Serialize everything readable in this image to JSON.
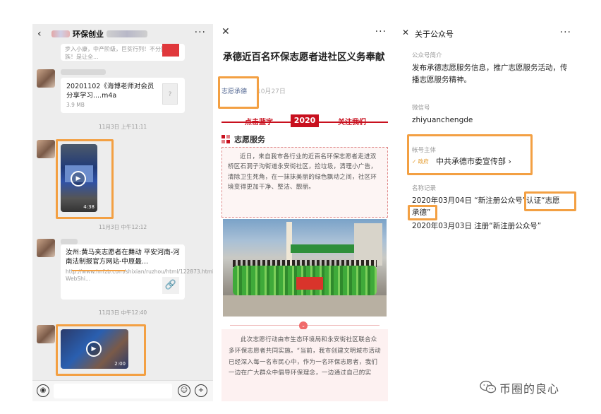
{
  "chat": {
    "title": "环保创业",
    "more": "···",
    "snippet": "步入小康，中产阶级，巨贫行列！不分民族种族！是让全...",
    "file": {
      "name": "20201102《海博老师对会员分享学习....m4a",
      "size": "3.9 MB",
      "icon_glyph": "?"
    },
    "timestamps": [
      "11月3日 上午11:11",
      "11月3日 中午12:12",
      "11月3日 中午12:40"
    ],
    "video1_duration": "4:38",
    "video2_duration": "2:00",
    "link": {
      "title": "汝州:黄马夹志愿者在舞动 平安河南-河南法制报官方网站-中原最...",
      "url": "http://www.hnfzb.com/shixian/ruzhou/html/122873.html?WebShi..."
    }
  },
  "article": {
    "title": "承德近百名环保志愿者进社区义务奉献",
    "author": "志愿承德",
    "date": "10月27日",
    "banner": {
      "left": "点击蓝字",
      "mid": "2020",
      "right": "关注我们"
    },
    "section_title": "志愿服务",
    "paragraph1": "近日，来自我市各行业的近百名环保志愿者走进双桥区石洞子沟街道永安街社区，捡垃圾，清理小广告，清除卫生死角，在一抹抹美丽的绿色飘动之间，社区环境变得更加干净、整洁、靓丽。",
    "paragraph2": "此次志愿行动由市生态环境局和永安街社区联合众多环保志愿者共同实施。“当前，我市创建文明城市活动已经深入每一名市民心中，作为一名环保志愿者，我们一边在广大群众中倡导环保理念，一边通过自己的实"
  },
  "account": {
    "header": "关于公众号",
    "intro_label": "公众号简介",
    "intro": "发布承德志愿服务信息，推广志愿服务活动，传播志愿服务精神。",
    "wechat_label": "微信号",
    "wechat_id": "zhiyuanchengde",
    "entity_label": "帐号主体",
    "verified": "✓ 政府",
    "entity": "中共承德市委宣传部 ›",
    "history_label": "名称记录",
    "history": [
      "2020年03月04日 “新注册公众号”认证“志愿承德”",
      "2020年03月03日 注册“新注册公众号”"
    ]
  },
  "watermark": {
    "text": "币圈的良心"
  },
  "colors": {
    "highlight": "#f3a043",
    "brand_red": "#c8101e",
    "wechat_link": "#576b95"
  }
}
